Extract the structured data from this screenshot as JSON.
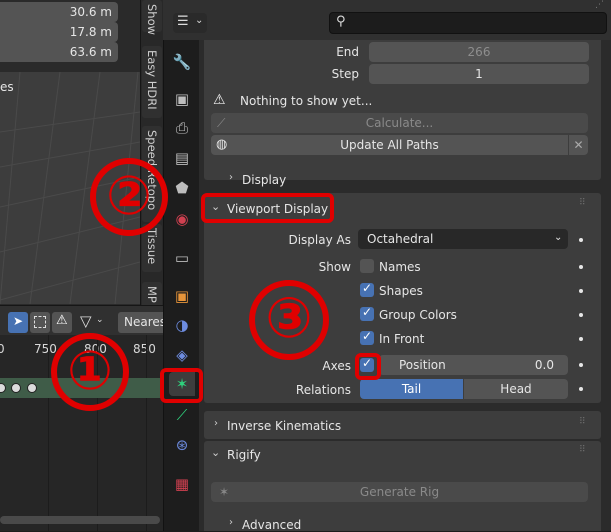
{
  "viewport": {
    "dimensions": [
      "30.6 m",
      "17.8 m",
      "63.6 m"
    ],
    "partial_label": "es"
  },
  "sidebar_tabs": [
    "Show",
    "Easy HDRI",
    "Speed Retopo",
    "Tissue",
    "MP"
  ],
  "timeline": {
    "filter_label": "Neares",
    "frame_numbers": [
      "0",
      "750",
      "800",
      "850"
    ]
  },
  "header": {
    "search_placeholder": ""
  },
  "motion_paths": {
    "end_label": "End",
    "end_value": "266",
    "step_label": "Step",
    "step_value": "1",
    "warning": "Nothing to show yet...",
    "calculate_label": "Calculate...",
    "update_label": "Update All Paths",
    "display_subpanel": "Display"
  },
  "viewport_display": {
    "title": "Viewport Display",
    "display_as_label": "Display As",
    "display_as_value": "Octahedral",
    "show_label": "Show",
    "names_label": "Names",
    "shapes_label": "Shapes",
    "group_colors_label": "Group Colors",
    "in_front_label": "In Front",
    "axes_label": "Axes",
    "axes_position_label": "Position",
    "axes_position_value": "0.0",
    "relations_label": "Relations",
    "relations_tail": "Tail",
    "relations_head": "Head"
  },
  "panels": {
    "inverse_kinematics": "Inverse Kinematics",
    "rigify": "Rigify",
    "generate_rig": "Generate Rig",
    "advanced": "Advanced"
  },
  "annotations": [
    "①",
    "②",
    "③"
  ],
  "colors": {
    "accent": "#4772b3",
    "annotation_red": "#e00000",
    "panel_bg": "#3d3d3d",
    "field_bg": "#545454"
  }
}
